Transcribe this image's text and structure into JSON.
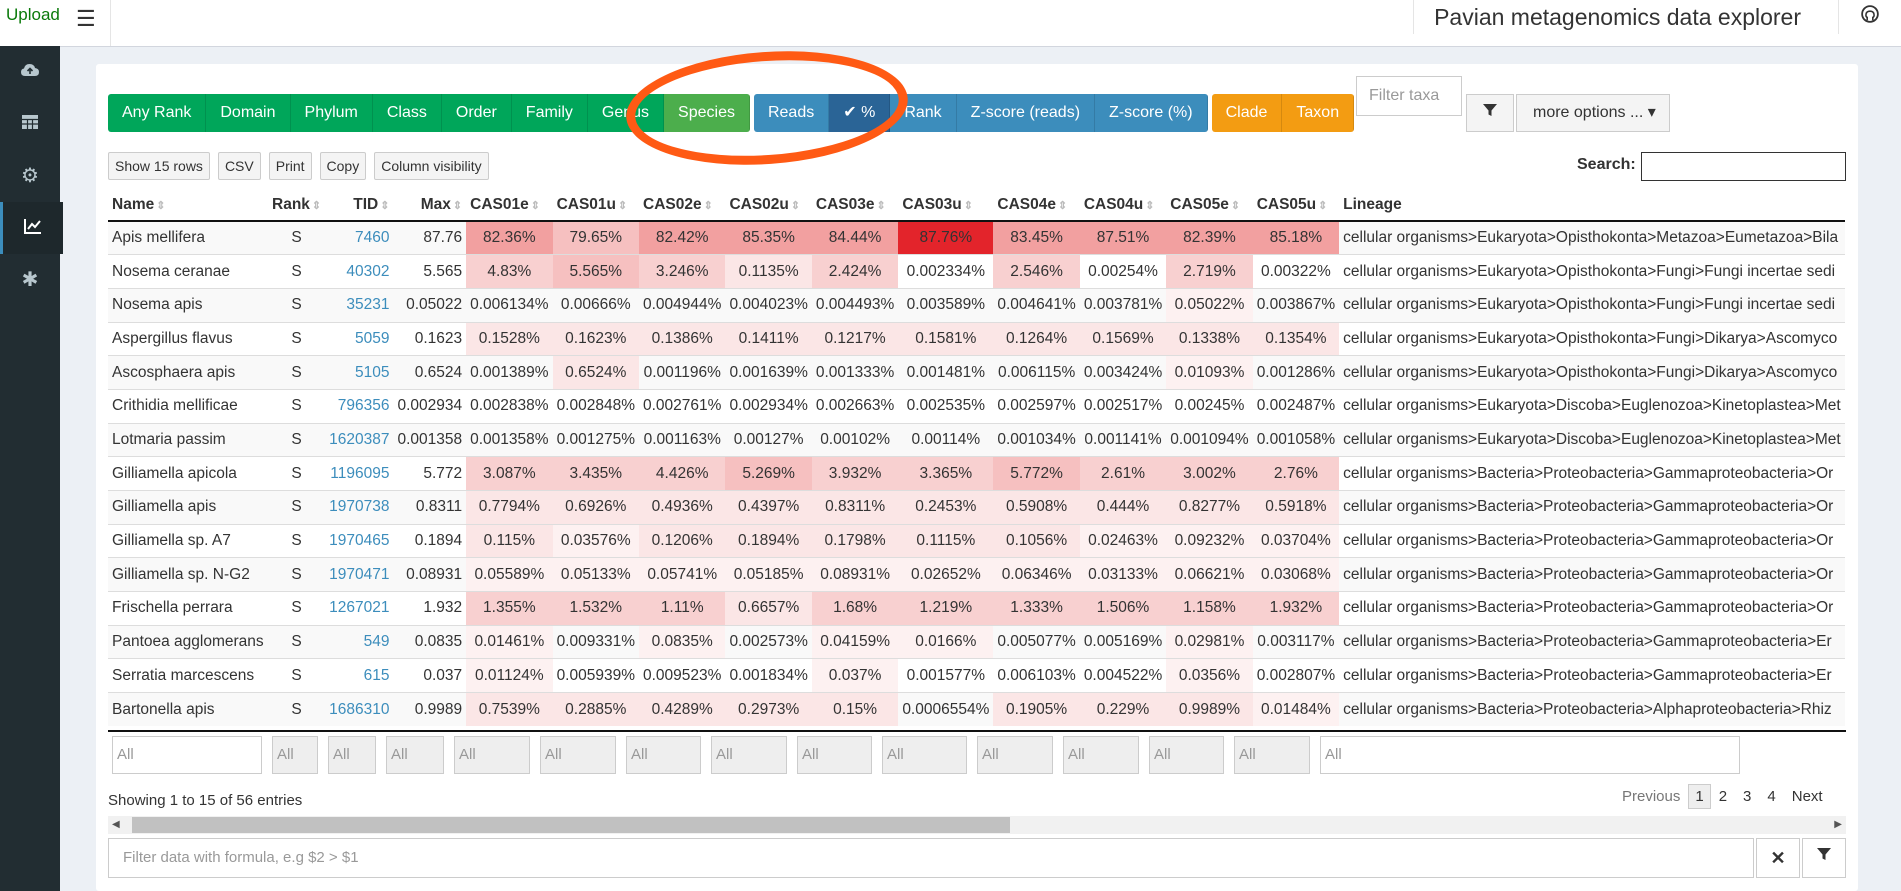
{
  "header": {
    "upload_label": "Upload",
    "app_title": "Pavian metagenomics data explorer"
  },
  "sidebar": [
    "upload-cloud-icon",
    "table-icon",
    "gear-icon",
    "line-chart-icon",
    "asterisk-icon"
  ],
  "toolbar": {
    "rank_buttons": [
      "Any Rank",
      "Domain",
      "Phylum",
      "Class",
      "Order",
      "Family",
      "Genus",
      "Species"
    ],
    "active_rank": "Species",
    "value_buttons": [
      "Reads",
      "%",
      "Rank",
      "Z-score (reads)",
      "Z-score (%)"
    ],
    "value_check": "✔",
    "clade_buttons": [
      "Clade",
      "Taxon"
    ],
    "filter_taxa_placeholder": "Filter taxa",
    "more_options": "more options ...",
    "more_caret": "▾"
  },
  "dt_buttons": [
    "Show 15 rows",
    "CSV",
    "Print",
    "Copy",
    "Column visibility"
  ],
  "search_label": "Search:",
  "table": {
    "columns": [
      "Name",
      "Rank",
      "TID",
      "Max",
      "CAS01e",
      "CAS01u",
      "CAS02e",
      "CAS02u",
      "CAS03e",
      "CAS03u",
      "CAS04e",
      "CAS04u",
      "CAS05e",
      "CAS05u",
      "Lineage"
    ],
    "rows": [
      [
        "Apis mellifera",
        "S",
        "7460",
        "87.76",
        "82.36%",
        "79.65%",
        "82.42%",
        "85.35%",
        "84.44%",
        "87.76%",
        "83.45%",
        "87.51%",
        "82.39%",
        "85.18%",
        "cellular organisms>Eukaryota>Opisthokonta>Metazoa>Eumetazoa>Bila"
      ],
      [
        "Nosema ceranae",
        "S",
        "40302",
        "5.565",
        "4.83%",
        "5.565%",
        "3.246%",
        "0.1135%",
        "2.424%",
        "0.002334%",
        "2.546%",
        "0.00254%",
        "2.719%",
        "0.00322%",
        "cellular organisms>Eukaryota>Opisthokonta>Fungi>Fungi incertae sedi"
      ],
      [
        "Nosema apis",
        "S",
        "35231",
        "0.05022",
        "0.006134%",
        "0.00666%",
        "0.004944%",
        "0.004023%",
        "0.004493%",
        "0.003589%",
        "0.004641%",
        "0.003781%",
        "0.05022%",
        "0.003867%",
        "cellular organisms>Eukaryota>Opisthokonta>Fungi>Fungi incertae sedi"
      ],
      [
        "Aspergillus flavus",
        "S",
        "5059",
        "0.1623",
        "0.1528%",
        "0.1623%",
        "0.1386%",
        "0.1411%",
        "0.1217%",
        "0.1581%",
        "0.1264%",
        "0.1569%",
        "0.1338%",
        "0.1354%",
        "cellular organisms>Eukaryota>Opisthokonta>Fungi>Dikarya>Ascomyco"
      ],
      [
        "Ascosphaera apis",
        "S",
        "5105",
        "0.6524",
        "0.001389%",
        "0.6524%",
        "0.001196%",
        "0.001639%",
        "0.001333%",
        "0.001481%",
        "0.006115%",
        "0.003424%",
        "0.01093%",
        "0.001286%",
        "cellular organisms>Eukaryota>Opisthokonta>Fungi>Dikarya>Ascomyco"
      ],
      [
        "Crithidia mellificae",
        "S",
        "796356",
        "0.002934",
        "0.002838%",
        "0.002848%",
        "0.002761%",
        "0.002934%",
        "0.002663%",
        "0.002535%",
        "0.002597%",
        "0.002517%",
        "0.00245%",
        "0.002487%",
        "cellular organisms>Eukaryota>Discoba>Euglenozoa>Kinetoplastea>Met"
      ],
      [
        "Lotmaria passim",
        "S",
        "1620387",
        "0.001358",
        "0.001358%",
        "0.001275%",
        "0.001163%",
        "0.00127%",
        "0.00102%",
        "0.00114%",
        "0.001034%",
        "0.001141%",
        "0.001094%",
        "0.001058%",
        "cellular organisms>Eukaryota>Discoba>Euglenozoa>Kinetoplastea>Met"
      ],
      [
        "Gilliamella apicola",
        "S",
        "1196095",
        "5.772",
        "3.087%",
        "3.435%",
        "4.426%",
        "5.269%",
        "3.932%",
        "3.365%",
        "5.772%",
        "2.61%",
        "3.002%",
        "2.76%",
        "cellular organisms>Bacteria>Proteobacteria>Gammaproteobacteria>Or"
      ],
      [
        "Gilliamella apis",
        "S",
        "1970738",
        "0.8311",
        "0.7794%",
        "0.6926%",
        "0.4936%",
        "0.4397%",
        "0.8311%",
        "0.2453%",
        "0.5908%",
        "0.444%",
        "0.8277%",
        "0.5918%",
        "cellular organisms>Bacteria>Proteobacteria>Gammaproteobacteria>Or"
      ],
      [
        "Gilliamella sp. A7",
        "S",
        "1970465",
        "0.1894",
        "0.115%",
        "0.03576%",
        "0.1206%",
        "0.1894%",
        "0.1798%",
        "0.1115%",
        "0.1056%",
        "0.02463%",
        "0.09232%",
        "0.03704%",
        "cellular organisms>Bacteria>Proteobacteria>Gammaproteobacteria>Or"
      ],
      [
        "Gilliamella sp. N-G2",
        "S",
        "1970471",
        "0.08931",
        "0.05589%",
        "0.05133%",
        "0.05741%",
        "0.05185%",
        "0.08931%",
        "0.02652%",
        "0.06346%",
        "0.03133%",
        "0.06621%",
        "0.03068%",
        "cellular organisms>Bacteria>Proteobacteria>Gammaproteobacteria>Or"
      ],
      [
        "Frischella perrara",
        "S",
        "1267021",
        "1.932",
        "1.355%",
        "1.532%",
        "1.11%",
        "0.6657%",
        "1.68%",
        "1.219%",
        "1.333%",
        "1.506%",
        "1.158%",
        "1.932%",
        "cellular organisms>Bacteria>Proteobacteria>Gammaproteobacteria>Or"
      ],
      [
        "Pantoea agglomerans",
        "S",
        "549",
        "0.0835",
        "0.01461%",
        "0.009331%",
        "0.0835%",
        "0.002573%",
        "0.04159%",
        "0.0166%",
        "0.005077%",
        "0.005169%",
        "0.02981%",
        "0.003117%",
        "cellular organisms>Bacteria>Proteobacteria>Gammaproteobacteria>Er"
      ],
      [
        "Serratia marcescens",
        "S",
        "615",
        "0.037",
        "0.01124%",
        "0.005939%",
        "0.009523%",
        "0.001834%",
        "0.037%",
        "0.001577%",
        "0.006103%",
        "0.004522%",
        "0.0356%",
        "0.002807%",
        "cellular organisms>Bacteria>Proteobacteria>Gammaproteobacteria>Er"
      ],
      [
        "Bartonella apis",
        "S",
        "1686310",
        "0.9989",
        "0.7539%",
        "0.2885%",
        "0.4289%",
        "0.2973%",
        "0.15%",
        "0.0006554%",
        "0.1905%",
        "0.229%",
        "0.9989%",
        "0.01484%",
        "cellular organisms>Bacteria>Proteobacteria>Alphaproteobacteria>Rhiz"
      ]
    ]
  },
  "column_filter_placeholder": "All",
  "info_text": "Showing 1 to 15 of 56 entries",
  "pagination": {
    "previous": "Previous",
    "pages": [
      "1",
      "2",
      "3",
      "4"
    ],
    "current": "1",
    "next": "Next"
  },
  "formula_placeholder": "Filter data with formula, e.g $2 > $1",
  "clear_symbol": "✕"
}
